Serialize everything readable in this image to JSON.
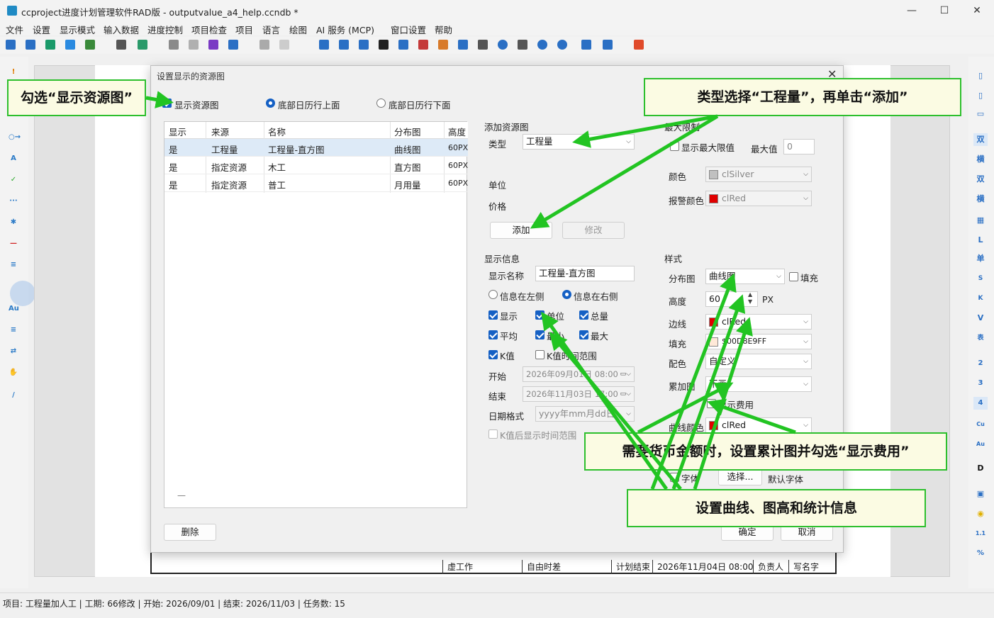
{
  "window": {
    "title": "ccproject进度计划管理软件RAD版 - outputvalue_a4_help.ccndb *",
    "minimize": "—",
    "maximize": "☐",
    "close": "✕"
  },
  "menu": [
    "文件",
    "设置",
    "显示模式",
    "输入数据",
    "进度控制",
    "项目检查",
    "项目",
    "语言",
    "绘图",
    "AI 服务 (MCP)",
    "窗口设置",
    "帮助"
  ],
  "right_toolbar": [
    "双",
    "横",
    "双",
    "横",
    "L",
    "单",
    "S",
    "K",
    "V",
    "表",
    "2",
    "3",
    "4",
    "Cu",
    "Au",
    "D",
    "1.1",
    "%"
  ],
  "status": {
    "text": "项目: 工程量加人工 | 工期: 66修改 | 开始: 2026/09/01 | 结束: 2026/11/03 | 任务数: 15"
  },
  "legend_row": [
    "虚工作",
    "自由时差",
    "计划结束",
    "2026年11月04日 08:00",
    "负责人",
    "写名字"
  ],
  "dialog": {
    "title": "设置显示的资源图",
    "close": "✕",
    "show_resource": {
      "label": "显示资源图",
      "checked": true
    },
    "position_radio": [
      {
        "label": "底部日历行上面",
        "selected": true
      },
      {
        "label": "底部日历行下面",
        "selected": false
      }
    ],
    "grid": {
      "headers": [
        "显示",
        "来源",
        "名称",
        "分布图",
        "高度"
      ],
      "rows": [
        [
          "是",
          "工程量",
          "工程量-直方图",
          "曲线图",
          "60PX"
        ],
        [
          "是",
          "指定资源",
          "木工",
          "直方图",
          "60PX"
        ],
        [
          "是",
          "指定资源",
          "普工",
          "月用量",
          "60PX"
        ]
      ],
      "footer_mark": "—"
    },
    "delete_button": "删除",
    "ok_button": "确定",
    "cancel_button": "取消",
    "add_group": {
      "title": "添加资源图",
      "type_label": "类型",
      "type_value": "工程量",
      "unit_label": "单位",
      "price_label": "价格",
      "add_button": "添加",
      "modify_button": "修改"
    },
    "max_group": {
      "title": "最大限制",
      "show_max_label": "显示最大限值",
      "max_label": "最大值",
      "max_value": "0",
      "color_label": "颜色",
      "color_value": "clSilver",
      "color_hex": "#c0c0c0",
      "alarm_color_label": "报警颜色",
      "alarm_color_value": "clRed",
      "alarm_color_hex": "#e00000"
    },
    "display_group": {
      "title": "显示信息",
      "name_label": "显示名称",
      "name_value": "工程量-直方图",
      "info_left": "信息在左侧",
      "info_right": "信息在右侧",
      "checks": [
        {
          "label": "显示",
          "checked": true
        },
        {
          "label": "单位",
          "checked": true
        },
        {
          "label": "总量",
          "checked": true
        },
        {
          "label": "平均",
          "checked": true
        },
        {
          "label": "最小",
          "checked": true
        },
        {
          "label": "最大",
          "checked": true
        },
        {
          "label": "K值",
          "checked": true
        },
        {
          "label": "K值时间范围",
          "checked": false
        }
      ],
      "start_label": "开始",
      "start_value": "2026年09月01日 08:00",
      "end_label": "结束",
      "end_value": "2026年11月03日 17:00",
      "date_format_label": "日期格式",
      "date_format_value": "yyyy年mm月dd日",
      "k_after_label": "K值后显示时间范围"
    },
    "style_group": {
      "title": "样式",
      "dist_label": "分布图",
      "dist_value": "曲线图",
      "fill_check_label": "填充",
      "height_label": "高度",
      "height_value": "60",
      "height_unit": "PX",
      "border_label": "边线",
      "border_value": "clRed",
      "border_hex": "#e00000",
      "fill_label": "填充",
      "fill_value": "$00D8E9FF",
      "fill_hex": "#ffe9d8",
      "scheme_label": "配色",
      "scheme_value": "自定义",
      "cumulative_label": "累加图",
      "cumulative_value": "不画",
      "show_cost_label": "显示费用",
      "curve_color_label": "曲线颜色",
      "curve_color_value": "clRed",
      "curve_color_hex": "#e00000",
      "font_check_label": "字体",
      "font_button": "选择...",
      "default_font": "默认字体"
    }
  },
  "callouts": {
    "c1": "勾选“显示资源图”",
    "c2": "类型选择“工程量”，再单击“添加”",
    "c3": "需要货币金额时，设置累计图并勾选“显示费用”",
    "c4": "设置曲线、图高和统计信息"
  },
  "colors": {
    "accent": "#1560c4",
    "callout_border": "#2dbf2d",
    "arrow": "#22c422"
  }
}
